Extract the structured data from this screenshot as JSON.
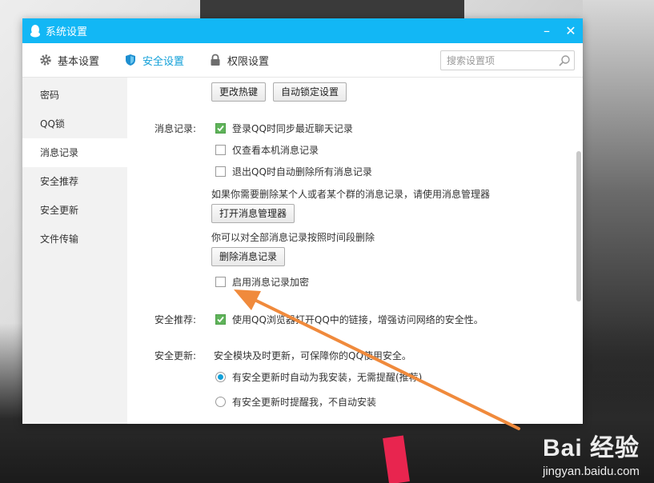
{
  "window": {
    "title": "系统设置",
    "minimize": "–",
    "close": "✕"
  },
  "tabs": [
    {
      "label": "基本设置",
      "icon": "gear-icon"
    },
    {
      "label": "安全设置",
      "icon": "shield-icon",
      "active": true
    },
    {
      "label": "权限设置",
      "icon": "lock-icon"
    }
  ],
  "search": {
    "placeholder": "搜索设置项"
  },
  "sidebar": {
    "items": [
      {
        "label": "密码"
      },
      {
        "label": "QQ锁"
      },
      {
        "label": "消息记录",
        "active": true
      },
      {
        "label": "安全推荐"
      },
      {
        "label": "安全更新"
      },
      {
        "label": "文件传输"
      }
    ]
  },
  "content": {
    "top_buttons": {
      "hotkey": "更改热键",
      "autolock": "自动锁定设置"
    },
    "message_records": {
      "section_label": "消息记录:",
      "sync_recent": {
        "label": "登录QQ时同步最近聊天记录",
        "checked": true
      },
      "local_only": {
        "label": "仅查看本机消息记录",
        "checked": false
      },
      "delete_on_exit": {
        "label": "退出QQ时自动删除所有消息记录",
        "checked": false
      },
      "manager_hint": "如果你需要删除某个人或者某个群的消息记录，请使用消息管理器",
      "open_manager_button": "打开消息管理器",
      "delete_hint": "你可以对全部消息记录按照时间段删除",
      "delete_button": "删除消息记录",
      "encrypt": {
        "label": "启用消息记录加密",
        "checked": false
      }
    },
    "security_recommend": {
      "section_label": "安全推荐:",
      "browser_links": {
        "label": "使用QQ浏览器打开QQ中的链接，增强访问网络的安全性。",
        "checked": true
      }
    },
    "security_update": {
      "section_label": "安全更新:",
      "desc": "安全模块及时更新，可保障你的QQ使用安全。",
      "auto_install": {
        "label": "有安全更新时自动为我安装，无需提醒(推荐)",
        "selected": true
      },
      "remind_only": {
        "label": "有安全更新时提醒我，不自动安装",
        "selected": false
      }
    }
  },
  "watermark": {
    "logo": "Bai 经验",
    "sub": "jingyan.baidu.com"
  },
  "colors": {
    "titlebar": "#12b7f5",
    "accent": "#12a0d8",
    "check": "#5fb35a",
    "arrow": "#f08a3c"
  }
}
